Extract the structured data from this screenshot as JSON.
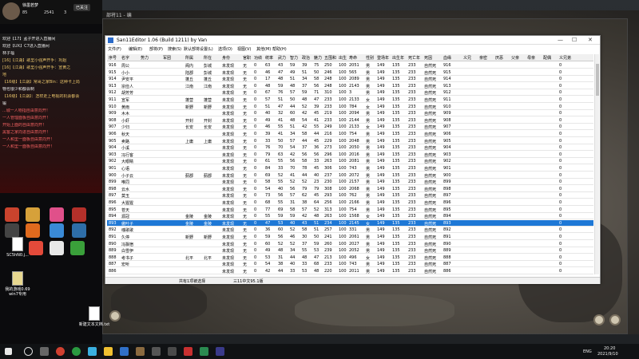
{
  "stream": {
    "user_name": "徐墨若梦",
    "stats": [
      "85",
      "2541",
      "3"
    ],
    "follow_btn": "已关注",
    "chat": [
      {
        "text": "欢迎【17】孟子开进入直播间",
        "color": "#e8e8e8"
      },
      {
        "text": "欢迎【UX】C7进入直播间",
        "color": "#e8e8e8"
      },
      {
        "text": "林子福",
        "color": "#e8e8e8"
      },
      {
        "text": "[16]【江湖】歌里小强声开手：巩姐",
        "color": "#e8c36a"
      },
      {
        "text": "[16]【江湖】歌里小强声开手：宣黄之",
        "color": "#e8c36a"
      },
      {
        "text": "地",
        "color": "#e8c36a"
      },
      {
        "text": "【16级】【江湖】常哥之家Bin：这种卡上局",
        "color": "#e8c36a"
      },
      {
        "text": "物也很少和都会制",
        "color": "#e8e8e8"
      },
      {
        "text": "【16级】【江湖】：怎样走上电视的机会都会",
        "color": "#e8c36a"
      },
      {
        "text": "锻",
        "color": "#e8e8e8"
      },
      {
        "text": "...城一人物指自由意向开！",
        "color": "#f06060"
      },
      {
        "text": "一人管理面板自由意向开！",
        "color": "#f06060"
      },
      {
        "text": "开始上面的自由意向开！",
        "color": "#f06060"
      },
      {
        "text": "黑客之家向进自由意向开！",
        "color": "#f06060"
      },
      {
        "text": "一人和里一面板自由意向开！",
        "color": "#f06060"
      },
      {
        "text": "一人和里一面板自由意向开！",
        "color": "#f06060"
      }
    ],
    "desk_icons": [
      "SC5hN0.j...",
      "我的游戏0.69 win7专用",
      "新建文本文档.txt"
    ]
  },
  "editor": {
    "game_title": "部将11 - 编",
    "title": "San11Editor 1.06 (Build 1211) by Van",
    "window_buttons": [
      "—",
      "☐",
      "✕"
    ],
    "menu": [
      "文件(F)",
      "编辑(E)",
      "部将(P)",
      "搜索(S)",
      "默认部将设置(L)",
      "选项(O)",
      "视图(V)",
      "其他(M)",
      "帮助(H)"
    ],
    "columns": [
      "序号",
      "名字",
      "势力",
      "军团",
      "所属",
      "所在",
      "身份",
      "官职",
      "功绩",
      "统率",
      "武力",
      "智力",
      "政治",
      "魅力",
      "五围和",
      "出生",
      "寿命",
      "性别",
      "登场年",
      "出生年",
      "死亡年",
      "死因",
      "血缘",
      "义兄",
      "亲密",
      "厌恶",
      "父亲",
      "母亲",
      "配偶",
      "义兄弟"
    ],
    "rows": [
      [
        "916",
        "周公",
        "",
        "",
        "阁内",
        "彭城",
        "未发现",
        "无",
        "0",
        "63",
        "43",
        "59",
        "39",
        "75",
        "250",
        "100",
        "2051",
        "男",
        "149",
        "135",
        "233",
        "自然死",
        "916",
        "",
        "",
        "",
        "",
        "",
        "",
        "0"
      ],
      [
        "915",
        "小小",
        "",
        "",
        "陆郡",
        "彭城",
        "未发现",
        "无",
        "0",
        "46",
        "47",
        "49",
        "51",
        "50",
        "246",
        "100",
        "565",
        "男",
        "149",
        "135",
        "233",
        "自然死",
        "915",
        "",
        "",
        "",
        "",
        "",
        "",
        "0"
      ],
      [
        "914",
        "尹安平",
        "",
        "",
        "蓬丘",
        "蓬丘",
        "未发现",
        "无",
        "0",
        "17",
        "48",
        "51",
        "34",
        "58",
        "248",
        "100",
        "2089",
        "男",
        "149",
        "135",
        "233",
        "自然死",
        "914",
        "",
        "",
        "",
        "",
        "",
        "",
        "0"
      ],
      [
        "913",
        "宗俭人",
        "",
        "",
        "江南",
        "江南",
        "未发现",
        "无",
        "0",
        "48",
        "59",
        "48",
        "37",
        "56",
        "248",
        "100",
        "2143",
        "男",
        "149",
        "135",
        "233",
        "自然死",
        "913",
        "",
        "",
        "",
        "",
        "",
        "",
        "0"
      ],
      [
        "912",
        "胡芳芳",
        "",
        "",
        "",
        "",
        "未发现",
        "无",
        "0",
        "67",
        "76",
        "57",
        "59",
        "71",
        "310",
        "100",
        "3",
        "男",
        "149",
        "135",
        "233",
        "自然死",
        "912",
        "",
        "",
        "",
        "",
        "",
        "",
        "0"
      ],
      [
        "911",
        "宣军",
        "",
        "",
        "蓬营",
        "蓬营",
        "未发现",
        "无",
        "0",
        "57",
        "51",
        "50",
        "48",
        "47",
        "233",
        "100",
        "2133",
        "女",
        "149",
        "135",
        "233",
        "自然死",
        "911",
        "",
        "",
        "",
        "",
        "",
        "",
        "0"
      ],
      [
        "910",
        "黄雨",
        "",
        "",
        "新野",
        "新野",
        "未发现",
        "无",
        "0",
        "51",
        "47",
        "44",
        "52",
        "39",
        "233",
        "100",
        "784",
        "女",
        "149",
        "135",
        "233",
        "自然死",
        "910",
        "",
        "",
        "",
        "",
        "",
        "",
        "0"
      ],
      [
        "909",
        "木木",
        "",
        "",
        "",
        "",
        "未发现",
        "无",
        "0",
        "40",
        "32",
        "60",
        "42",
        "45",
        "219",
        "100",
        "2094",
        "男",
        "149",
        "135",
        "233",
        "自然死",
        "909",
        "",
        "",
        "",
        "",
        "",
        "",
        "0"
      ],
      [
        "908",
        "小虾",
        "",
        "",
        "开封",
        "开封",
        "未发现",
        "无",
        "0",
        "49",
        "41",
        "48",
        "54",
        "41",
        "233",
        "100",
        "2144",
        "男",
        "149",
        "135",
        "233",
        "自然死",
        "908",
        "",
        "",
        "",
        "",
        "",
        "",
        "0"
      ],
      [
        "907",
        "少归",
        "",
        "",
        "长安",
        "长安",
        "未发现",
        "无",
        "0",
        "46",
        "55",
        "51",
        "42",
        "55",
        "249",
        "100",
        "2133",
        "女",
        "149",
        "135",
        "233",
        "自然死",
        "907",
        "",
        "",
        "",
        "",
        "",
        "",
        "0"
      ],
      [
        "906",
        "秋天",
        "",
        "",
        "",
        "",
        "未发现",
        "无",
        "0",
        "39",
        "41",
        "34",
        "58",
        "44",
        "216",
        "100",
        "754",
        "男",
        "149",
        "135",
        "233",
        "自然死",
        "906",
        "",
        "",
        "",
        "",
        "",
        "",
        "0"
      ],
      [
        "905",
        "卖路",
        "",
        "",
        "上庸",
        "上庸",
        "未发现",
        "无",
        "0",
        "33",
        "50",
        "57",
        "44",
        "45",
        "229",
        "100",
        "2048",
        "男",
        "149",
        "135",
        "233",
        "自然死",
        "905",
        "",
        "",
        "",
        "",
        "",
        "",
        "0"
      ],
      [
        "904",
        "小溪",
        "",
        "",
        "",
        "",
        "未发现",
        "无",
        "0",
        "76",
        "70",
        "54",
        "37",
        "36",
        "273",
        "100",
        "2050",
        "男",
        "149",
        "135",
        "233",
        "自然死",
        "904",
        "",
        "",
        "",
        "",
        "",
        "",
        "0"
      ],
      [
        "903",
        "冯行客",
        "",
        "",
        "",
        "",
        "未发现",
        "无",
        "0",
        "79",
        "63",
        "42",
        "56",
        "56",
        "296",
        "100",
        "2016",
        "男",
        "149",
        "135",
        "233",
        "自然死",
        "903",
        "",
        "",
        "",
        "",
        "",
        "",
        "0"
      ],
      [
        "902",
        "大眼睛",
        "",
        "",
        "",
        "",
        "未发现",
        "无",
        "0",
        "61",
        "55",
        "56",
        "58",
        "33",
        "263",
        "100",
        "2081",
        "男",
        "149",
        "135",
        "233",
        "自然死",
        "902",
        "",
        "",
        "",
        "",
        "",
        "",
        "0"
      ],
      [
        "901",
        "心语",
        "",
        "",
        "",
        "",
        "未发现",
        "无",
        "0",
        "84",
        "33",
        "70",
        "78",
        "45",
        "306",
        "100",
        "743",
        "男",
        "149",
        "135",
        "233",
        "自然死",
        "901",
        "",
        "",
        "",
        "",
        "",
        "",
        "0"
      ],
      [
        "900",
        "小子云",
        "",
        "",
        "蓟郡",
        "蓟郡",
        "未发现",
        "无",
        "0",
        "69",
        "52",
        "41",
        "44",
        "40",
        "237",
        "100",
        "2072",
        "男",
        "149",
        "135",
        "233",
        "自然死",
        "900",
        "",
        "",
        "",
        "",
        "",
        "",
        "0"
      ],
      [
        "899",
        "唯同",
        "",
        "",
        "",
        "",
        "未发现",
        "无",
        "0",
        "58",
        "55",
        "52",
        "52",
        "23",
        "230",
        "100",
        "2157",
        "男",
        "149",
        "135",
        "233",
        "自然死",
        "899",
        "",
        "",
        "",
        "",
        "",
        "",
        "0"
      ],
      [
        "898",
        "云水",
        "",
        "",
        "",
        "",
        "未发现",
        "无",
        "0",
        "54",
        "40",
        "56",
        "79",
        "79",
        "308",
        "100",
        "2068",
        "男",
        "149",
        "135",
        "233",
        "自然死",
        "898",
        "",
        "",
        "",
        "",
        "",
        "",
        "0"
      ],
      [
        "897",
        "莫玉",
        "",
        "",
        "",
        "",
        "未发现",
        "无",
        "0",
        "73",
        "56",
        "57",
        "62",
        "45",
        "293",
        "100",
        "762",
        "男",
        "149",
        "135",
        "233",
        "自然死",
        "897",
        "",
        "",
        "",
        "",
        "",
        "",
        "0"
      ],
      [
        "896",
        "大猩猩",
        "",
        "",
        "",
        "",
        "未发现",
        "无",
        "0",
        "68",
        "55",
        "31",
        "38",
        "64",
        "256",
        "100",
        "2166",
        "男",
        "149",
        "135",
        "233",
        "自然死",
        "896",
        "",
        "",
        "",
        "",
        "",
        "",
        "0"
      ],
      [
        "895",
        "苍天",
        "",
        "",
        "",
        "",
        "未发现",
        "无",
        "0",
        "77",
        "69",
        "58",
        "57",
        "52",
        "313",
        "100",
        "754",
        "男",
        "149",
        "135",
        "233",
        "自然死",
        "895",
        "",
        "",
        "",
        "",
        "",
        "",
        "0"
      ],
      [
        "894",
        "源冠",
        "",
        "",
        "金陵",
        "金陵",
        "未发现",
        "无",
        "0",
        "55",
        "59",
        "59",
        "42",
        "48",
        "263",
        "100",
        "1568",
        "女",
        "149",
        "135",
        "233",
        "自然死",
        "894",
        "",
        "",
        "",
        "",
        "",
        "",
        "0"
      ],
      [
        "893",
        "傲叶子",
        "",
        "",
        "金陵",
        "金陵",
        "未发现",
        "无",
        "0",
        "47",
        "53",
        "40",
        "43",
        "51",
        "234",
        "100",
        "2145",
        "女",
        "149",
        "135",
        "233",
        "自然死",
        "893",
        "",
        "",
        "",
        "",
        "",
        "",
        "0"
      ],
      [
        "892",
        "魂歌歌",
        "",
        "",
        "",
        "",
        "未发现",
        "无",
        "0",
        "36",
        "60",
        "52",
        "58",
        "51",
        "257",
        "100",
        "331",
        "男",
        "149",
        "135",
        "233",
        "自然死",
        "892",
        "",
        "",
        "",
        "",
        "",
        "",
        "0"
      ],
      [
        "891",
        "久停",
        "",
        "",
        "新野",
        "新野",
        "未发现",
        "无",
        "0",
        "59",
        "56",
        "46",
        "30",
        "50",
        "241",
        "100",
        "2061",
        "男",
        "149",
        "135",
        "233",
        "自然死",
        "891",
        "",
        "",
        "",
        "",
        "",
        "",
        "0"
      ],
      [
        "890",
        "冯飘宿",
        "",
        "",
        "",
        "",
        "未发现",
        "无",
        "0",
        "60",
        "52",
        "52",
        "37",
        "59",
        "260",
        "100",
        "2027",
        "男",
        "149",
        "135",
        "233",
        "自然死",
        "890",
        "",
        "",
        "",
        "",
        "",
        "",
        "0"
      ],
      [
        "889",
        "白雪伊",
        "",
        "",
        "",
        "",
        "未发现",
        "无",
        "0",
        "49",
        "48",
        "34",
        "55",
        "53",
        "239",
        "100",
        "2052",
        "男",
        "149",
        "135",
        "233",
        "自然死",
        "889",
        "",
        "",
        "",
        "",
        "",
        "",
        "0"
      ],
      [
        "888",
        "考书子",
        "",
        "",
        "北平",
        "北平",
        "未发现",
        "无",
        "0",
        "53",
        "31",
        "44",
        "48",
        "47",
        "213",
        "100",
        "496",
        "女",
        "149",
        "135",
        "233",
        "自然死",
        "888",
        "",
        "",
        "",
        "",
        "",
        "",
        "0"
      ],
      [
        "887",
        "宏听",
        "",
        "",
        "",
        "",
        "未发现",
        "无",
        "0",
        "54",
        "38",
        "40",
        "33",
        "68",
        "233",
        "100",
        "743",
        "男",
        "149",
        "135",
        "233",
        "自然死",
        "887",
        "",
        "",
        "",
        "",
        "",
        "",
        "0"
      ],
      [
        "886",
        "",
        "",
        "",
        "",
        "",
        "未发现",
        "无",
        "0",
        "42",
        "44",
        "33",
        "53",
        "48",
        "220",
        "100",
        "2011",
        "男",
        "149",
        "135",
        "233",
        "自然死",
        "886",
        "",
        "",
        "",
        "",
        "",
        "",
        "0"
      ]
    ],
    "selected_row": 23,
    "status": [
      "共有1项被选择",
      "三11中文95.1版"
    ]
  },
  "taskbar": {
    "lang": "ENG",
    "time": "20:20",
    "date": "2021/9/10"
  }
}
